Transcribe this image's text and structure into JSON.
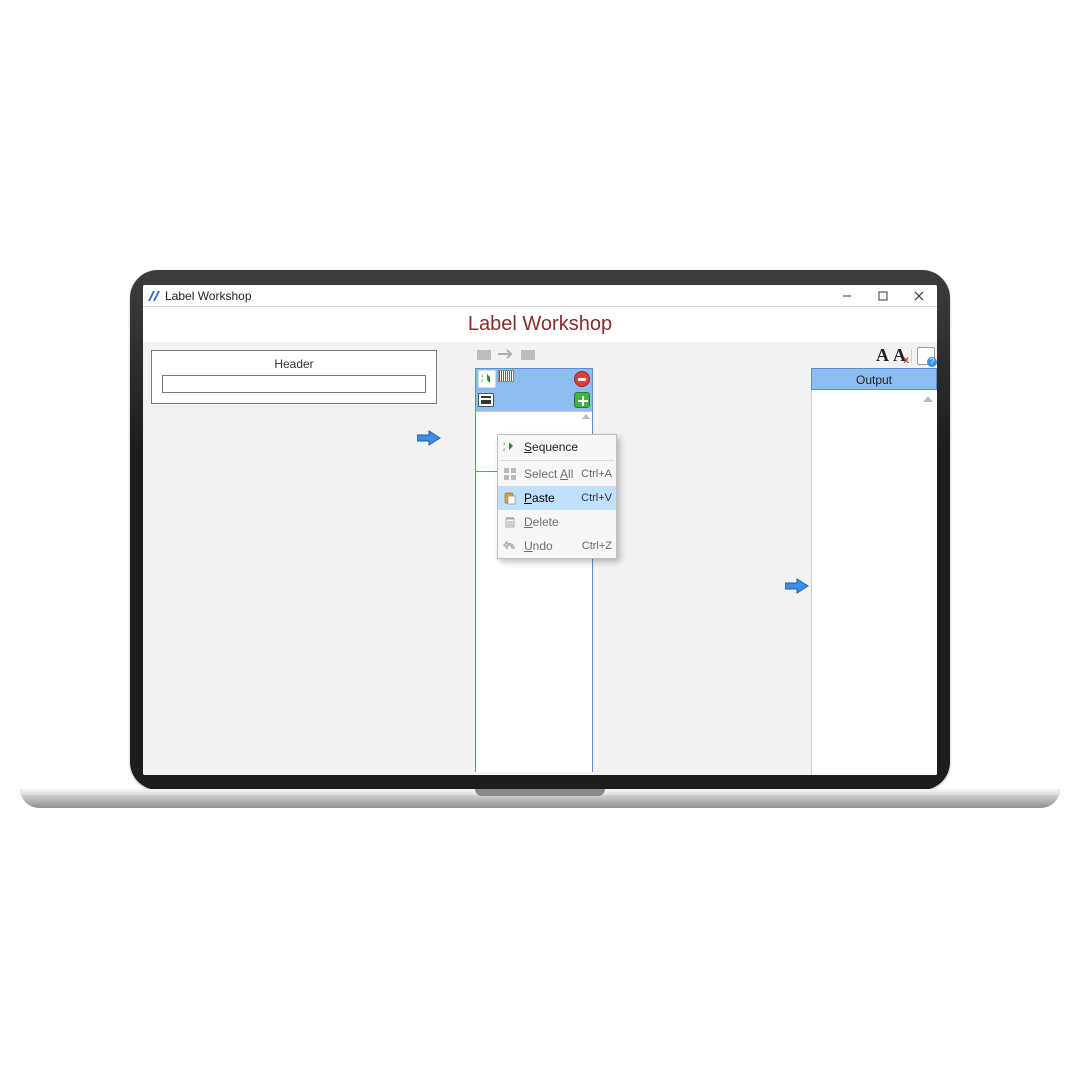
{
  "titlebar": {
    "title": "Label Workshop"
  },
  "heading": "Label Workshop",
  "leftPanel": {
    "title": "Header",
    "inputValue": ""
  },
  "output": {
    "title": "Output"
  },
  "contextMenu": {
    "items": [
      {
        "label": "Sequence",
        "accel": "S",
        "shortcut": "",
        "icon": "sequence-icon",
        "enabled": true
      },
      {
        "label": "Select All",
        "accel": "A",
        "shortcut": "Ctrl+A",
        "icon": "select-all-icon",
        "enabled": false
      },
      {
        "label": "Paste",
        "accel": "P",
        "shortcut": "Ctrl+V",
        "icon": "paste-icon",
        "enabled": true,
        "highlight": true
      },
      {
        "label": "Delete",
        "accel": "D",
        "shortcut": "",
        "icon": "delete-icon",
        "enabled": false
      },
      {
        "label": "Undo",
        "accel": "U",
        "shortcut": "Ctrl+Z",
        "icon": "undo-icon",
        "enabled": false
      }
    ]
  }
}
